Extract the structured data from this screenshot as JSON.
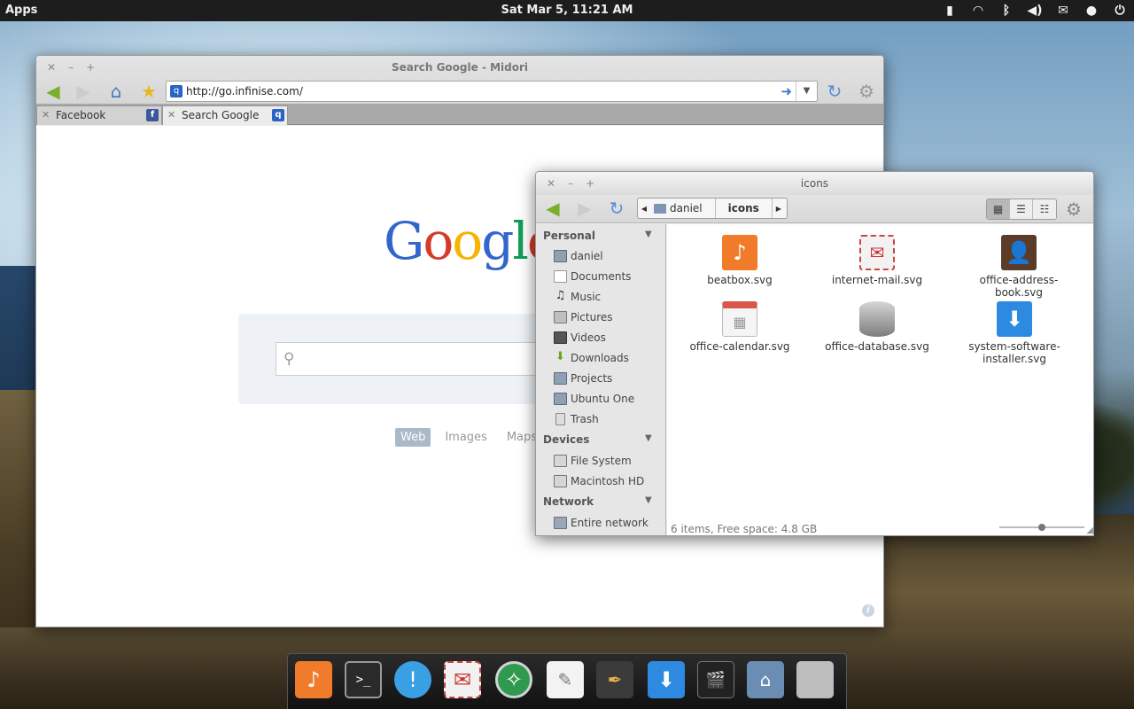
{
  "panel": {
    "apps_label": "Apps",
    "clock": "Sat Mar  5, 11:21 AM",
    "tray_icons": [
      "battery-icon",
      "wifi-icon",
      "bluetooth-icon",
      "volume-icon",
      "mail-icon",
      "chat-icon",
      "power-icon"
    ]
  },
  "browser": {
    "title": "Search Google - Midori",
    "url": "http://go.infinise.com/",
    "tabs": [
      {
        "label": "Facebook",
        "icon": "f"
      },
      {
        "label": "Search Google",
        "icon": "q"
      }
    ],
    "page": {
      "logo": "Google",
      "nav": [
        "Web",
        "Images",
        "Maps"
      ]
    }
  },
  "files": {
    "title": "icons",
    "crumbs": [
      "daniel",
      "icons"
    ],
    "sidebar": {
      "personal_header": "Personal",
      "personal": [
        "daniel",
        "Documents",
        "Music",
        "Pictures",
        "Videos",
        "Downloads",
        "Projects",
        "Ubuntu One",
        "Trash"
      ],
      "devices_header": "Devices",
      "devices": [
        "File System",
        "Macintosh HD"
      ],
      "network_header": "Network",
      "network": [
        "Entire network"
      ]
    },
    "items": [
      {
        "name": "beatbox.svg",
        "icon": "music-note-icon",
        "color": "#f07b2a"
      },
      {
        "name": "internet-mail.svg",
        "icon": "envelope-icon",
        "color": "#e9e9e9"
      },
      {
        "name": "office-address-book.svg",
        "icon": "address-book-icon",
        "color": "#5a3c28"
      },
      {
        "name": "office-calendar.svg",
        "icon": "calendar-icon",
        "color": "#d9574a"
      },
      {
        "name": "office-database.svg",
        "icon": "database-icon",
        "color": "#8c8c8c"
      },
      {
        "name": "system-software-installer.svg",
        "icon": "download-arrow-icon",
        "color": "#2d8ae0"
      }
    ],
    "status": "6 items, Free space: 4.8 GB"
  },
  "dock": [
    "music-icon",
    "terminal-icon",
    "notification-icon",
    "mail-icon",
    "browser-compass-icon",
    "text-editor-icon",
    "graphics-pen-icon",
    "installer-icon",
    "video-icon",
    "home-folder-icon",
    "trash-icon"
  ]
}
